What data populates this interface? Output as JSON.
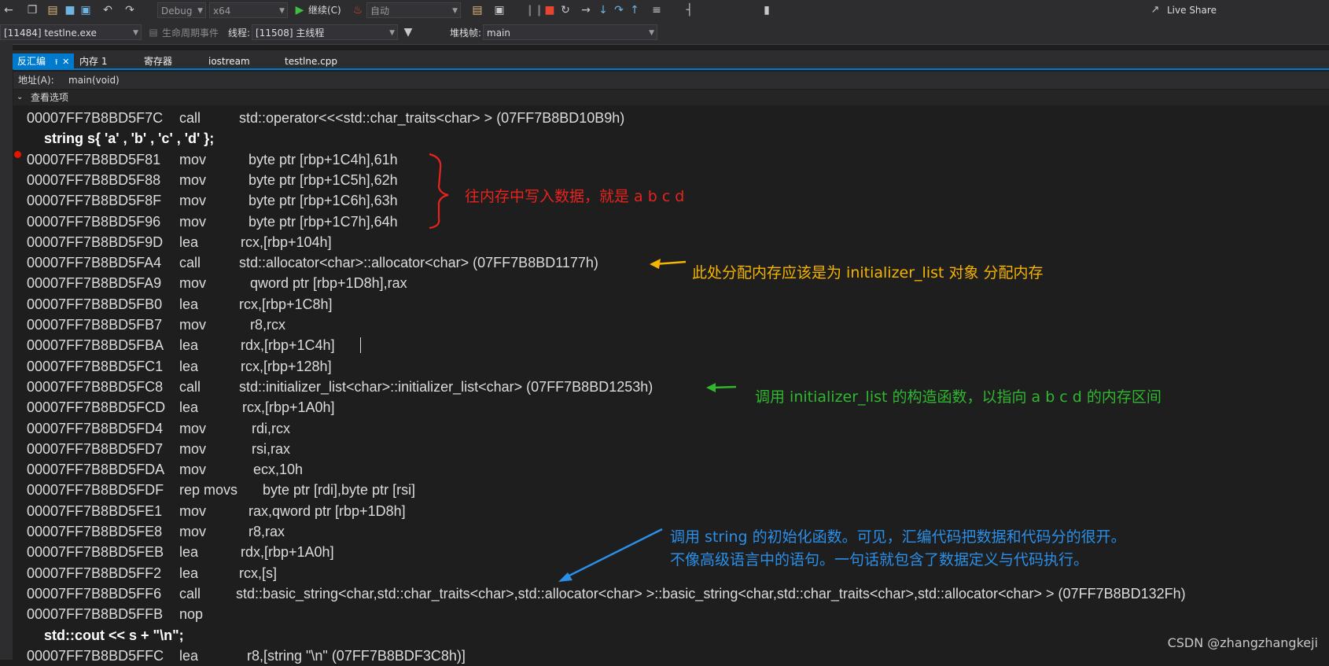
{
  "toolbar": {
    "config": "Debug",
    "platform": "x64",
    "continue_label": "继续(C)",
    "auto_label": "自动",
    "live_share": "Live Share"
  },
  "debugbar": {
    "process": "[11484] testlne.exe",
    "lifecycle": "生命周期事件",
    "thread_label": "线程:",
    "thread": "[11508] 主线程",
    "stackframe_label": "堆栈帧:",
    "stackframe": "main"
  },
  "tabs": [
    {
      "label": "反汇编"
    },
    {
      "label": "内存 1"
    },
    {
      "label": "寄存器"
    },
    {
      "label": "iostream"
    },
    {
      "label": "testlne.cpp"
    }
  ],
  "address": {
    "label": "地址(A):",
    "value": "main(void)"
  },
  "view_options": "查看选项",
  "code_lines": [
    {
      "kind": "asm",
      "addr": "00007FF7B8BD5F7C",
      "mn": "call",
      "op": "std::operator<<<std::char_traits<char> > (07FF7B8BD10B9h)"
    },
    {
      "kind": "src",
      "text": "string s{ 'a' , 'b' , 'c' , 'd' };"
    },
    {
      "kind": "asm",
      "addr": "00007FF7B8BD5F81",
      "mn": "mov",
      "op": "byte ptr [rbp+1C4h],61h"
    },
    {
      "kind": "asm",
      "addr": "00007FF7B8BD5F88",
      "mn": "mov",
      "op": "byte ptr [rbp+1C5h],62h"
    },
    {
      "kind": "asm",
      "addr": "00007FF7B8BD5F8F",
      "mn": "mov",
      "op": "byte ptr [rbp+1C6h],63h"
    },
    {
      "kind": "asm",
      "addr": "00007FF7B8BD5F96",
      "mn": "mov",
      "op": "byte ptr [rbp+1C7h],64h"
    },
    {
      "kind": "asm",
      "addr": "00007FF7B8BD5F9D",
      "mn": "lea",
      "op": "rcx,[rbp+104h]"
    },
    {
      "kind": "asm",
      "addr": "00007FF7B8BD5FA4",
      "mn": "call",
      "op": "std::allocator<char>::allocator<char> (07FF7B8BD1177h)"
    },
    {
      "kind": "asm",
      "addr": "00007FF7B8BD5FA9",
      "mn": "mov",
      "op": "qword ptr [rbp+1D8h],rax"
    },
    {
      "kind": "asm",
      "addr": "00007FF7B8BD5FB0",
      "mn": "lea",
      "op": "rcx,[rbp+1C8h]"
    },
    {
      "kind": "asm",
      "addr": "00007FF7B8BD5FB7",
      "mn": "mov",
      "op": "r8,rcx"
    },
    {
      "kind": "asm",
      "addr": "00007FF7B8BD5FBA",
      "mn": "lea",
      "op": "rdx,[rbp+1C4h]"
    },
    {
      "kind": "asm",
      "addr": "00007FF7B8BD5FC1",
      "mn": "lea",
      "op": "rcx,[rbp+128h]"
    },
    {
      "kind": "asm",
      "addr": "00007FF7B8BD5FC8",
      "mn": "call",
      "op": "std::initializer_list<char>::initializer_list<char> (07FF7B8BD1253h)"
    },
    {
      "kind": "asm",
      "addr": "00007FF7B8BD5FCD",
      "mn": "lea",
      "op": "rcx,[rbp+1A0h]"
    },
    {
      "kind": "asm",
      "addr": "00007FF7B8BD5FD4",
      "mn": "mov",
      "op": "rdi,rcx"
    },
    {
      "kind": "asm",
      "addr": "00007FF7B8BD5FD7",
      "mn": "mov",
      "op": "rsi,rax"
    },
    {
      "kind": "asm",
      "addr": "00007FF7B8BD5FDA",
      "mn": "mov",
      "op": "ecx,10h"
    },
    {
      "kind": "asm",
      "addr": "00007FF7B8BD5FDF",
      "mn": "rep movs",
      "op": "byte ptr [rdi],byte ptr [rsi]"
    },
    {
      "kind": "asm",
      "addr": "00007FF7B8BD5FE1",
      "mn": "mov",
      "op": "rax,qword ptr [rbp+1D8h]"
    },
    {
      "kind": "asm",
      "addr": "00007FF7B8BD5FE8",
      "mn": "mov",
      "op": "r8,rax"
    },
    {
      "kind": "asm",
      "addr": "00007FF7B8BD5FEB",
      "mn": "lea",
      "op": "rdx,[rbp+1A0h]"
    },
    {
      "kind": "asm",
      "addr": "00007FF7B8BD5FF2",
      "mn": "lea",
      "op": "rcx,[s]"
    },
    {
      "kind": "asm",
      "addr": "00007FF7B8BD5FF6",
      "mn": "call",
      "op": "std::basic_string<char,std::char_traits<char>,std::allocator<char> >::basic_string<char,std::char_traits<char>,std::allocator<char> > (07FF7B8BD132Fh)"
    },
    {
      "kind": "asm",
      "addr": "00007FF7B8BD5FFB",
      "mn": "nop",
      "op": ""
    },
    {
      "kind": "src",
      "text": "std::cout << s + \"\\n\";"
    },
    {
      "kind": "asm",
      "addr": "00007FF7B8BD5FFC",
      "mn": "lea",
      "op": "r8,[string \"\\n\" (07FF7B8BDF3C8h)]"
    }
  ],
  "annotations": {
    "red": "往内存中写入数据，就是 a b c d",
    "orange": "此处分配内存应该是为 initializer_list 对象 分配内存",
    "green": "调用 initializer_list 的构造函数，以指向 a b c d 的内存区间",
    "blue_line1": "调用 string 的初始化函数。可见，汇编代码把数据和代码分的很开。",
    "blue_line2": "不像高级语言中的语句。一句话就包含了数据定义与代码执行。",
    "colors": {
      "red": "#e8231e",
      "orange": "#f5b400",
      "green": "#2fb82f",
      "blue": "#2b8fe8"
    }
  },
  "watermark": "CSDN @zhangzhangkeji"
}
